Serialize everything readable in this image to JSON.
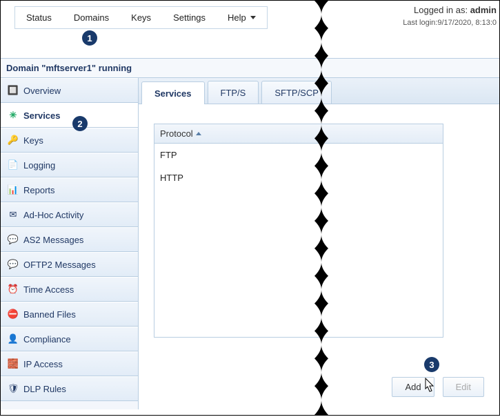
{
  "top_menu": {
    "status": "Status",
    "domains": "Domains",
    "keys": "Keys",
    "settings": "Settings",
    "help": "Help"
  },
  "login": {
    "prefix": "Logged in as: ",
    "user": "admin",
    "last_prefix": "Last login:",
    "last_value": "9/17/2020, 8:13:0"
  },
  "domain_header": "Domain \"mftserver1\" running",
  "sidebar": {
    "items": [
      {
        "label": "Overview"
      },
      {
        "label": "Services"
      },
      {
        "label": "Keys"
      },
      {
        "label": "Logging"
      },
      {
        "label": "Reports"
      },
      {
        "label": "Ad-Hoc Activity"
      },
      {
        "label": "AS2 Messages"
      },
      {
        "label": "OFTP2 Messages"
      },
      {
        "label": "Time Access"
      },
      {
        "label": "Banned Files"
      },
      {
        "label": "Compliance"
      },
      {
        "label": "IP Access"
      },
      {
        "label": "DLP Rules"
      }
    ]
  },
  "tabs": {
    "items": [
      {
        "label": "Services"
      },
      {
        "label": "FTP/S"
      },
      {
        "label": "SFTP/SCP"
      }
    ]
  },
  "grid": {
    "header": "Protocol",
    "rows": [
      {
        "protocol": "FTP"
      },
      {
        "protocol": "HTTP"
      }
    ]
  },
  "buttons": {
    "add": "Add",
    "edit": "Edit"
  },
  "annotations": {
    "one": "1",
    "two": "2",
    "three": "3"
  }
}
